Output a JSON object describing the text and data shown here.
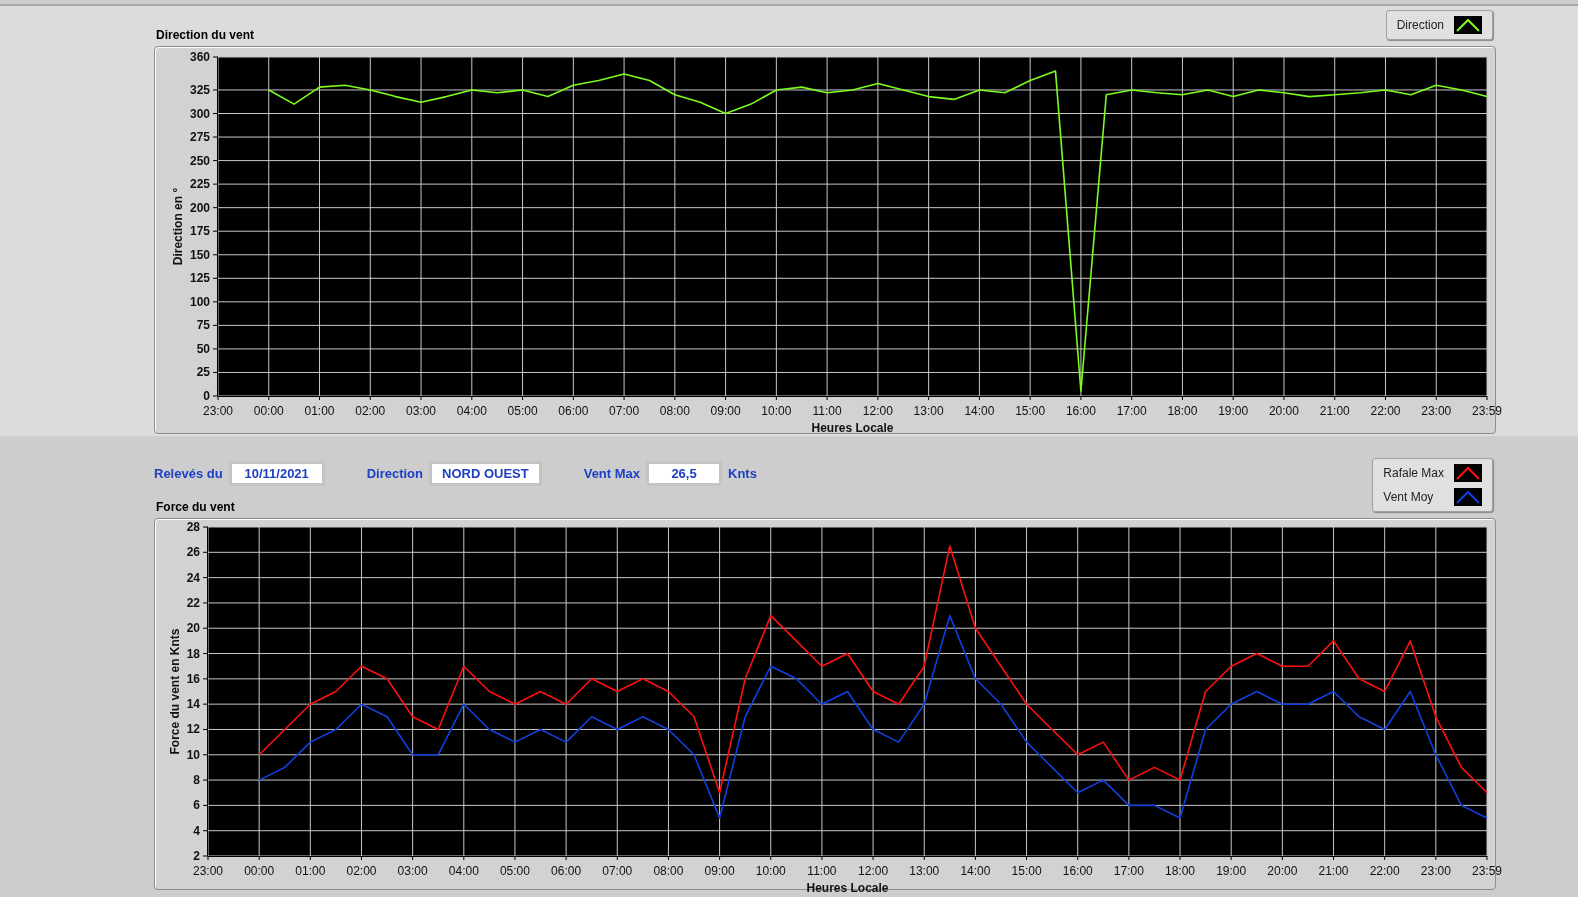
{
  "direction_panel": {
    "title": "Direction du vent",
    "chart_data": {
      "type": "line",
      "grid": true,
      "xlabel": "Heures Locale",
      "ylabel": "Direction en °",
      "ylim": [
        0,
        360
      ],
      "categories": [
        "23:00",
        null,
        "00:00",
        null,
        "01:00",
        null,
        "02:00",
        null,
        "03:00",
        null,
        "04:00",
        null,
        "05:00",
        null,
        "06:00",
        null,
        "07:00",
        null,
        "08:00",
        null,
        "09:00",
        null,
        "10:00",
        null,
        "11:00",
        null,
        "12:00",
        null,
        "13:00",
        null,
        "14:00",
        null,
        "15:00",
        null,
        "16:00",
        null,
        "17:00",
        null,
        "18:00",
        null,
        "19:00",
        null,
        "20:00",
        null,
        "21:00",
        null,
        "22:00",
        null,
        "23:00",
        null,
        "23:59"
      ],
      "yticks": [
        0,
        25,
        50,
        75,
        100,
        125,
        150,
        175,
        200,
        225,
        250,
        275,
        300,
        325,
        360
      ],
      "series": [
        {
          "name": "Direction",
          "color": "#7cfc1c",
          "values": [
            null,
            null,
            325,
            310,
            328,
            330,
            325,
            318,
            312,
            318,
            325,
            322,
            325,
            318,
            330,
            335,
            342,
            335,
            320,
            312,
            300,
            310,
            325,
            328,
            322,
            325,
            332,
            325,
            318,
            315,
            325,
            322,
            335,
            345,
            5,
            320,
            325,
            322,
            320,
            325,
            318,
            325,
            322,
            318,
            320,
            322,
            325,
            320,
            330,
            325,
            318
          ]
        }
      ]
    }
  },
  "readings": [
    {
      "label": "Relevés du",
      "value": "10/11/2021"
    },
    {
      "label": "Direction",
      "value": "NORD OUEST"
    },
    {
      "label": "Vent Max",
      "value": "26,5",
      "unit": "Knts"
    }
  ],
  "force_panel": {
    "title": "Force du vent",
    "chart_data": {
      "type": "line",
      "grid": true,
      "xlabel": "Heures Locale",
      "ylabel": "Force du vent en Knts",
      "ylim": [
        2,
        28
      ],
      "categories": [
        "23:00",
        null,
        "00:00",
        null,
        "01:00",
        null,
        "02:00",
        null,
        "03:00",
        null,
        "04:00",
        null,
        "05:00",
        null,
        "06:00",
        null,
        "07:00",
        null,
        "08:00",
        null,
        "09:00",
        null,
        "10:00",
        null,
        "11:00",
        null,
        "12:00",
        null,
        "13:00",
        null,
        "14:00",
        null,
        "15:00",
        null,
        "16:00",
        null,
        "17:00",
        null,
        "18:00",
        null,
        "19:00",
        null,
        "20:00",
        null,
        "21:00",
        null,
        "22:00",
        null,
        "23:00",
        null,
        "23:59"
      ],
      "yticks": [
        2,
        4,
        6,
        8,
        10,
        12,
        14,
        16,
        18,
        20,
        22,
        24,
        26,
        28
      ],
      "series": [
        {
          "name": "Rafale Max",
          "color": "#ff1010",
          "values": [
            null,
            null,
            10,
            12,
            14,
            15,
            17,
            16,
            13,
            12,
            17,
            15,
            14,
            15,
            14,
            16,
            15,
            16,
            15,
            13,
            7,
            16,
            21,
            19,
            17,
            18,
            15,
            14,
            17,
            26.5,
            20,
            17,
            14,
            12,
            10,
            11,
            8,
            9,
            8,
            15,
            17,
            18,
            17,
            17,
            19,
            16,
            15,
            19,
            13,
            9,
            7
          ]
        },
        {
          "name": "Vent Moy",
          "color": "#1040e0",
          "values": [
            null,
            null,
            8,
            9,
            11,
            12,
            14,
            13,
            10,
            10,
            14,
            12,
            11,
            12,
            11,
            13,
            12,
            13,
            12,
            10,
            5,
            13,
            17,
            16,
            14,
            15,
            12,
            11,
            14,
            21,
            16,
            14,
            11,
            9,
            7,
            8,
            6,
            6,
            5,
            12,
            14,
            15,
            14,
            14,
            15,
            13,
            12,
            15,
            10,
            6,
            5
          ]
        }
      ]
    }
  }
}
